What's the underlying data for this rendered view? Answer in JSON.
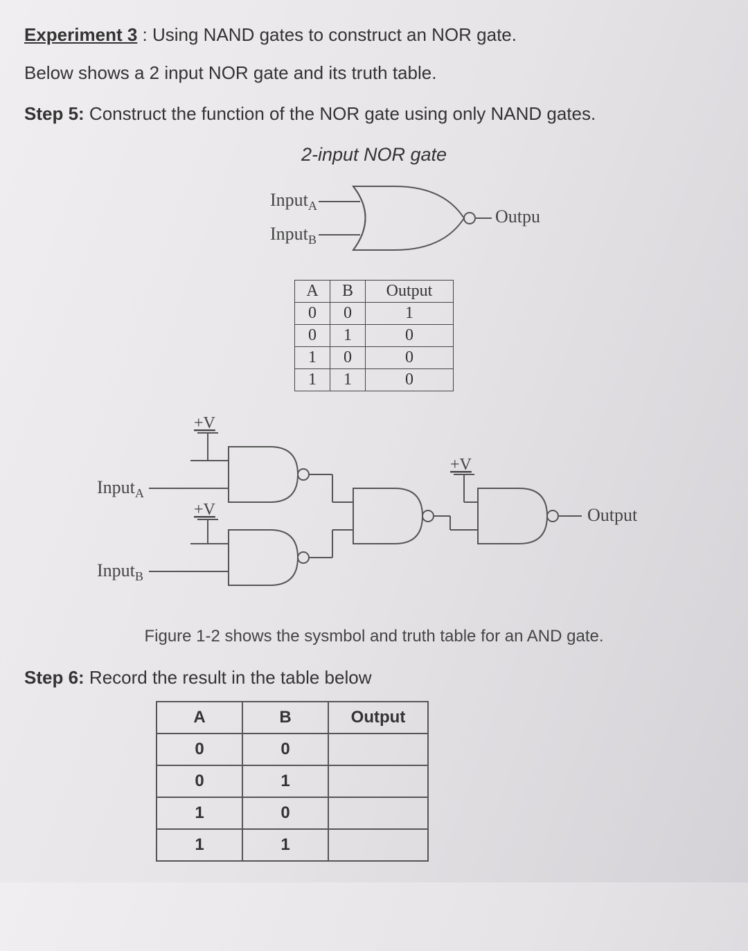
{
  "heading": {
    "title": "Experiment 3",
    "subtitle": ": Using NAND gates to construct an NOR gate."
  },
  "intro": "Below shows a 2 input NOR gate and its truth table.",
  "step5": {
    "label": "Step 5:",
    "text": " Construct the function of the NOR gate using only NAND gates."
  },
  "figure_title": "2-input NOR gate",
  "gate_labels": {
    "input_a": "Input",
    "input_a_sub": "A",
    "input_b": "Input",
    "input_b_sub": "B",
    "output": "Output",
    "plus_v": "+V"
  },
  "truth_table_ref": {
    "headers": [
      "A",
      "B",
      "Output"
    ],
    "rows": [
      [
        "0",
        "0",
        "1"
      ],
      [
        "0",
        "1",
        "0"
      ],
      [
        "1",
        "0",
        "0"
      ],
      [
        "1",
        "1",
        "0"
      ]
    ]
  },
  "caption": "Figure 1-2 shows the sysmbol and truth table for an AND gate.",
  "step6": {
    "label": "Step 6:",
    "text": " Record the result in the table below"
  },
  "result_table": {
    "headers": [
      "A",
      "B",
      "Output"
    ],
    "rows": [
      [
        "0",
        "0",
        ""
      ],
      [
        "0",
        "1",
        ""
      ],
      [
        "1",
        "0",
        ""
      ],
      [
        "1",
        "1",
        ""
      ]
    ]
  }
}
